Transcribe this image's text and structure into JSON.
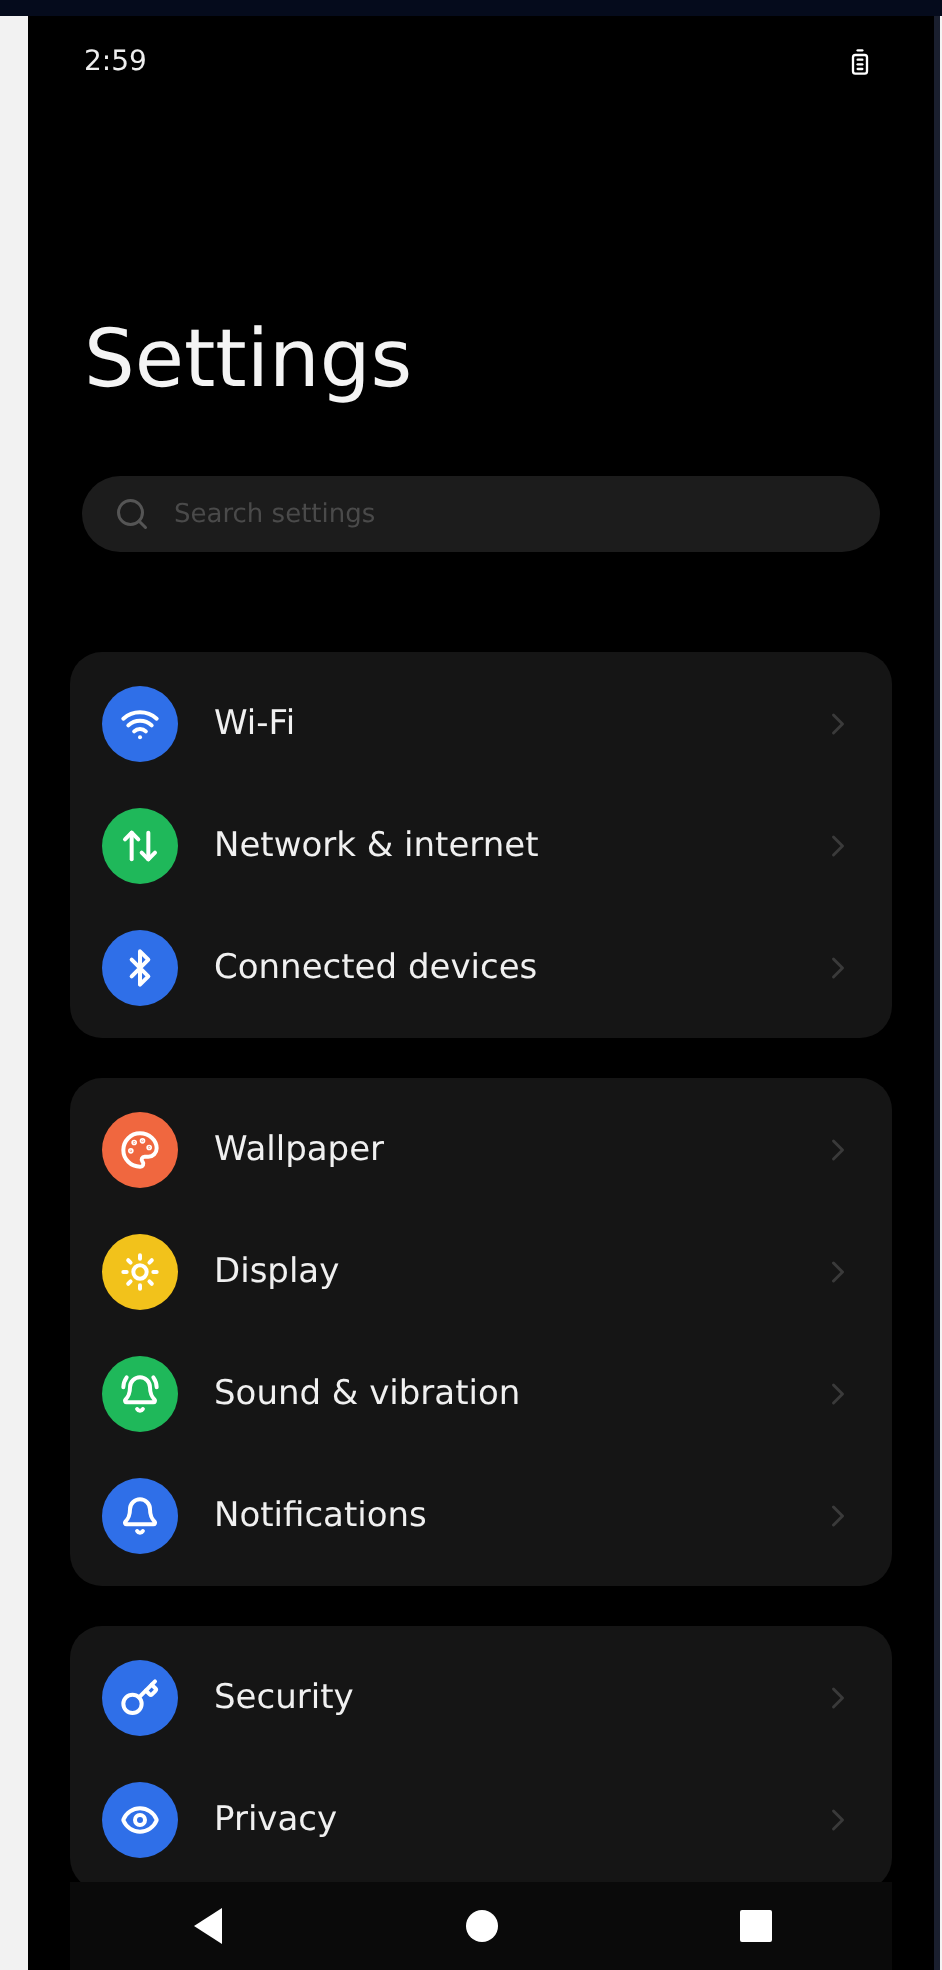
{
  "status_bar": {
    "time": "2:59"
  },
  "title": "Settings",
  "search": {
    "placeholder": "Search settings"
  },
  "groups": [
    {
      "items": [
        {
          "label": "Wi-Fi",
          "color": "#2f6fe8"
        },
        {
          "label": "Network & internet",
          "color": "#1fb85a"
        },
        {
          "label": "Connected devices",
          "color": "#2f6fe8"
        }
      ]
    },
    {
      "items": [
        {
          "label": "Wallpaper",
          "color": "#f0673f"
        },
        {
          "label": "Display",
          "color": "#f2c21b"
        },
        {
          "label": "Sound & vibration",
          "color": "#1fb85a"
        },
        {
          "label": "Notifications",
          "color": "#2f6fe8"
        }
      ]
    },
    {
      "items": [
        {
          "label": "Security",
          "color": "#2f6fe8"
        },
        {
          "label": "Privacy",
          "color": "#2f6fe8"
        }
      ]
    }
  ]
}
